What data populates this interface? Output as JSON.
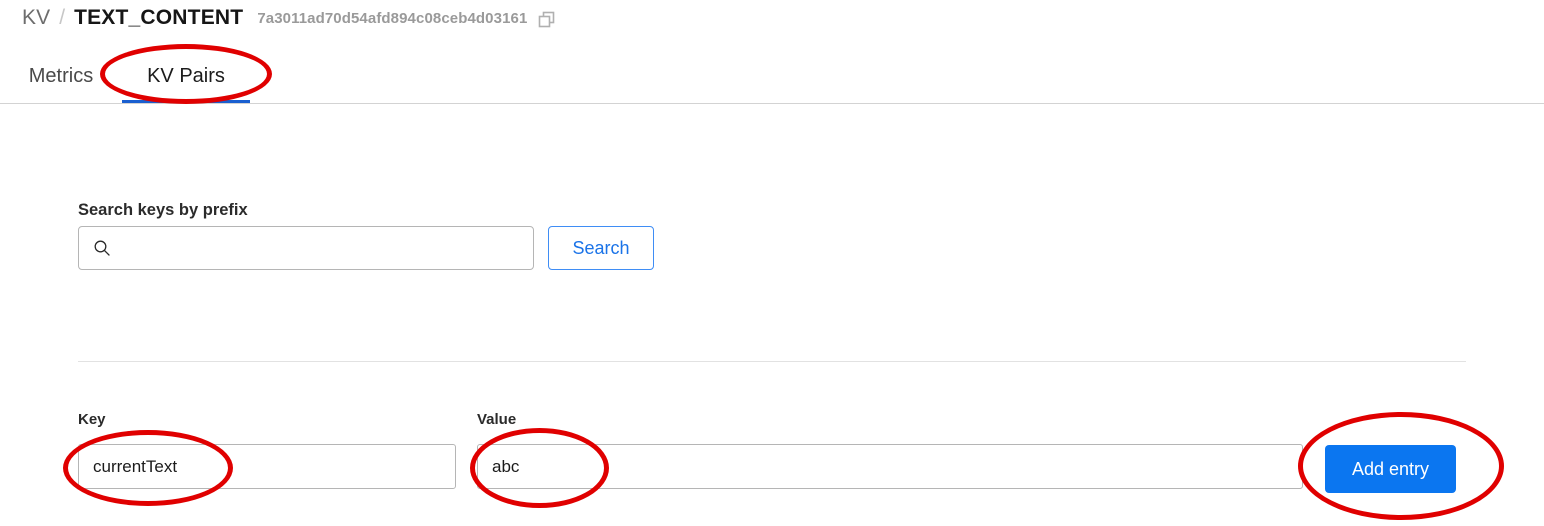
{
  "breadcrumb": {
    "root": "KV",
    "separator": "/",
    "current": "TEXT_CONTENT",
    "id": "7a3011ad70d54afd894c08ceb4d03161",
    "copy_icon": "copy-icon"
  },
  "tabs": [
    {
      "label": "Metrics",
      "active": false
    },
    {
      "label": "KV Pairs",
      "active": true
    }
  ],
  "search": {
    "label": "Search keys by prefix",
    "value": "",
    "placeholder": "",
    "icon": "search-icon",
    "button_label": "Search"
  },
  "entry_form": {
    "key_label": "Key",
    "key_value": "currentText",
    "key_placeholder": "",
    "value_label": "Value",
    "value_value": "abc",
    "value_placeholder": "",
    "add_button_label": "Add entry"
  },
  "colors": {
    "accent_blue": "#0b76f0",
    "link_blue": "#1a73e8",
    "tab_underline": "#1a5fd0",
    "annotation_red": "#e00000",
    "muted_text": "#9a9a9a",
    "border_gray": "#b5b5b5"
  },
  "annotations": [
    {
      "target": "tab-kvpairs",
      "shape": "ellipse",
      "color": "#e00000"
    },
    {
      "target": "key-input",
      "shape": "ellipse",
      "color": "#e00000"
    },
    {
      "target": "value-input",
      "shape": "ellipse",
      "color": "#e00000"
    },
    {
      "target": "add-entry-button",
      "shape": "ellipse",
      "color": "#e00000"
    }
  ]
}
